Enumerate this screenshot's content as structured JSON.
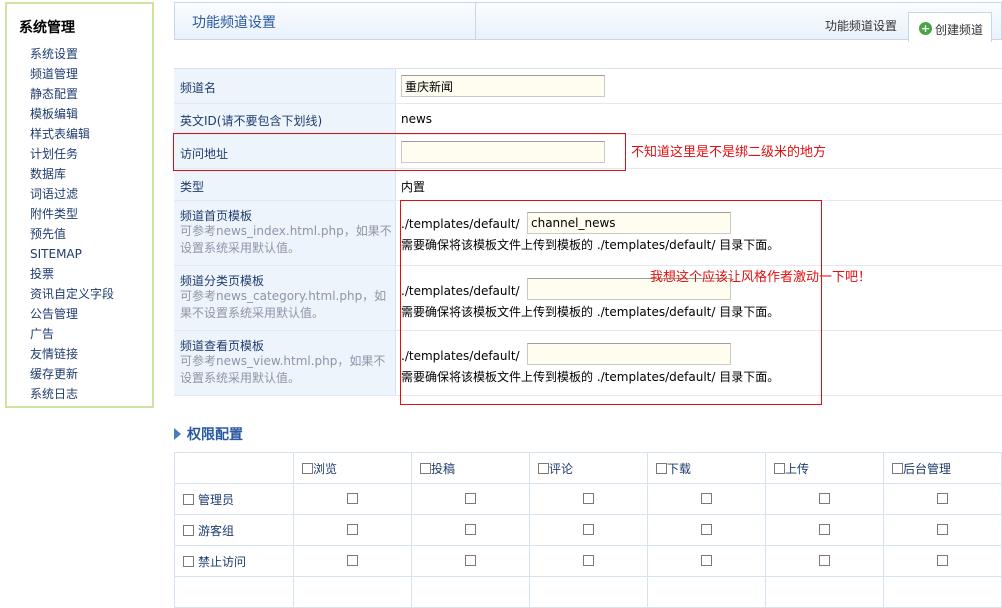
{
  "sidebar": {
    "title": "系统管理",
    "items": [
      "系统设置",
      "频道管理",
      "静态配置",
      "模板编辑",
      "样式表编辑",
      "计划任务",
      "数据库",
      "词语过滤",
      "附件类型",
      "预先值",
      "SITEMAP",
      "投票",
      "资讯自定义字段",
      "公告管理",
      "广告",
      "友情链接",
      "缓存更新",
      "系统日志"
    ]
  },
  "header": {
    "title": "功能频道设置",
    "tab_func": "功能频道设置",
    "tab_create": "创建频道"
  },
  "form": {
    "channel_name": {
      "label": "频道名",
      "value": "重庆新闻"
    },
    "english_id": {
      "label": "英文ID(请不要包含下划线)",
      "value": "news"
    },
    "access_url": {
      "label": "访问地址",
      "value": ""
    },
    "type": {
      "label": "类型",
      "value": "内置"
    },
    "index_tpl": {
      "label": "频道首页模板",
      "hint": "可参考news_index.html.php，如果不设置系统采用默认值。",
      "prefix": "./templates/default/",
      "value": "channel_news",
      "note": "需要确保将该模板文件上传到模板的 ./templates/default/ 目录下面。"
    },
    "category_tpl": {
      "label": "频道分类页模板",
      "hint": "可参考news_category.html.php，如果不设置系统采用默认值。",
      "prefix": "./templates/default/",
      "value": "",
      "note": "需要确保将该模板文件上传到模板的 ./templates/default/ 目录下面。"
    },
    "view_tpl": {
      "label": "频道查看页模板",
      "hint": "可参考news_view.html.php，如果不设置系统采用默认值。",
      "prefix": "./templates/default/",
      "value": "",
      "note": "需要确保将该模板文件上传到模板的 ./templates/default/ 目录下面。"
    }
  },
  "annotations": {
    "a1": "不知道这里是不是绑二级米的地方",
    "a2": "我想这个应该让风格作者激动一下吧！"
  },
  "permissions": {
    "title": "权限配置",
    "columns": [
      "浏览",
      "投稿",
      "评论",
      "下载",
      "上传",
      "后台管理"
    ],
    "rows": [
      "管理员",
      "游客组",
      "禁止访问"
    ]
  },
  "colors": {
    "accent": "#2a5aa0",
    "annotation": "#e01010",
    "sidebar_border": "#cfe3a0"
  }
}
